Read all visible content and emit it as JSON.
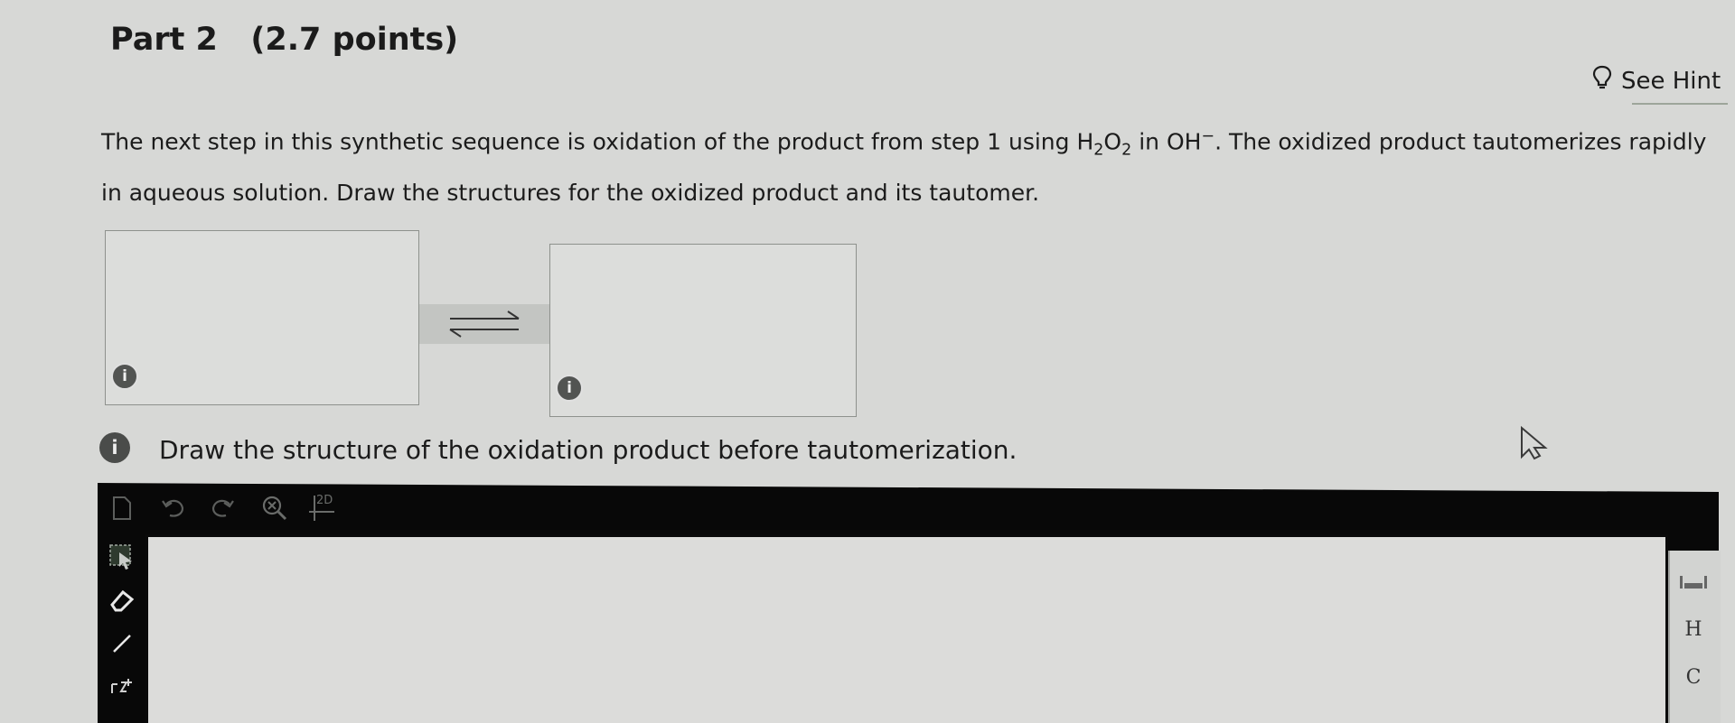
{
  "part": {
    "title": "Part 2   (2.7 points)"
  },
  "hint": {
    "label": "See Hint",
    "icon": "lightbulb-icon"
  },
  "question": {
    "prefix": "The next step in this synthetic sequence is oxidation of the product from step 1 using ",
    "reagent1_a": "H",
    "reagent1_sub1": "2",
    "reagent1_b": "O",
    "reagent1_sub2": "2",
    "connector": " in ",
    "reagent2": "OH",
    "reagent2_sup": "−",
    "suffix": ". The oxidized product tautomerizes rapidly in aqueous solution. Draw the structures for the oxidized product and its tautomer."
  },
  "draw_boxes": {
    "box1_info": "i",
    "box2_info": "i"
  },
  "instruction": {
    "icon_text": "i",
    "text": "Draw the structure of the oxidation product before tautomerization."
  },
  "toolbar": {
    "icons": [
      "new-document-icon",
      "undo-icon",
      "redo-icon",
      "zoom-icon",
      "2d-cleanup-icon"
    ],
    "cleanup_label": "2D"
  },
  "left_tools": [
    "select-tool-icon",
    "eraser-icon",
    "bond-tool-icon",
    "charge-tool-icon"
  ],
  "atoms": {
    "hydrogen": "H",
    "carbon": "C"
  },
  "colors": {
    "background": "#d7d8d6",
    "toolbar": "#080808",
    "info_icon": "#525452"
  }
}
